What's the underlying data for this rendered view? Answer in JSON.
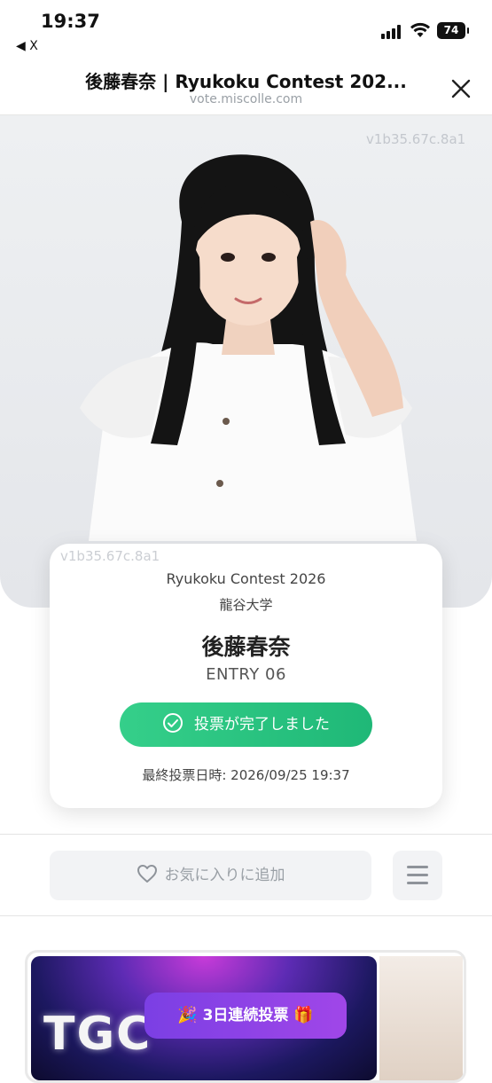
{
  "status_bar": {
    "time": "19:37",
    "back_app": "◀ X",
    "battery": "74"
  },
  "header": {
    "title": "後藤春奈 | Ryukoku Contest 202...",
    "url": "vote.miscolle.com"
  },
  "hero": {
    "watermark": "v1b35.67c.8a1"
  },
  "card": {
    "contest": "Ryukoku Contest 2026",
    "university": "龍谷大学",
    "name": "後藤春奈",
    "entry": "ENTRY 06",
    "vote_done_label": "投票が完了しました",
    "last_vote": "最終投票日時: 2026/09/25 19:37"
  },
  "actions": {
    "favorite_label": "お気に入りに追加"
  },
  "banner": {
    "text": "TGC",
    "streak_label": "3日連続投票"
  },
  "colors": {
    "accent_green": "#2bc480",
    "streak_purple": "#8b43e6"
  }
}
